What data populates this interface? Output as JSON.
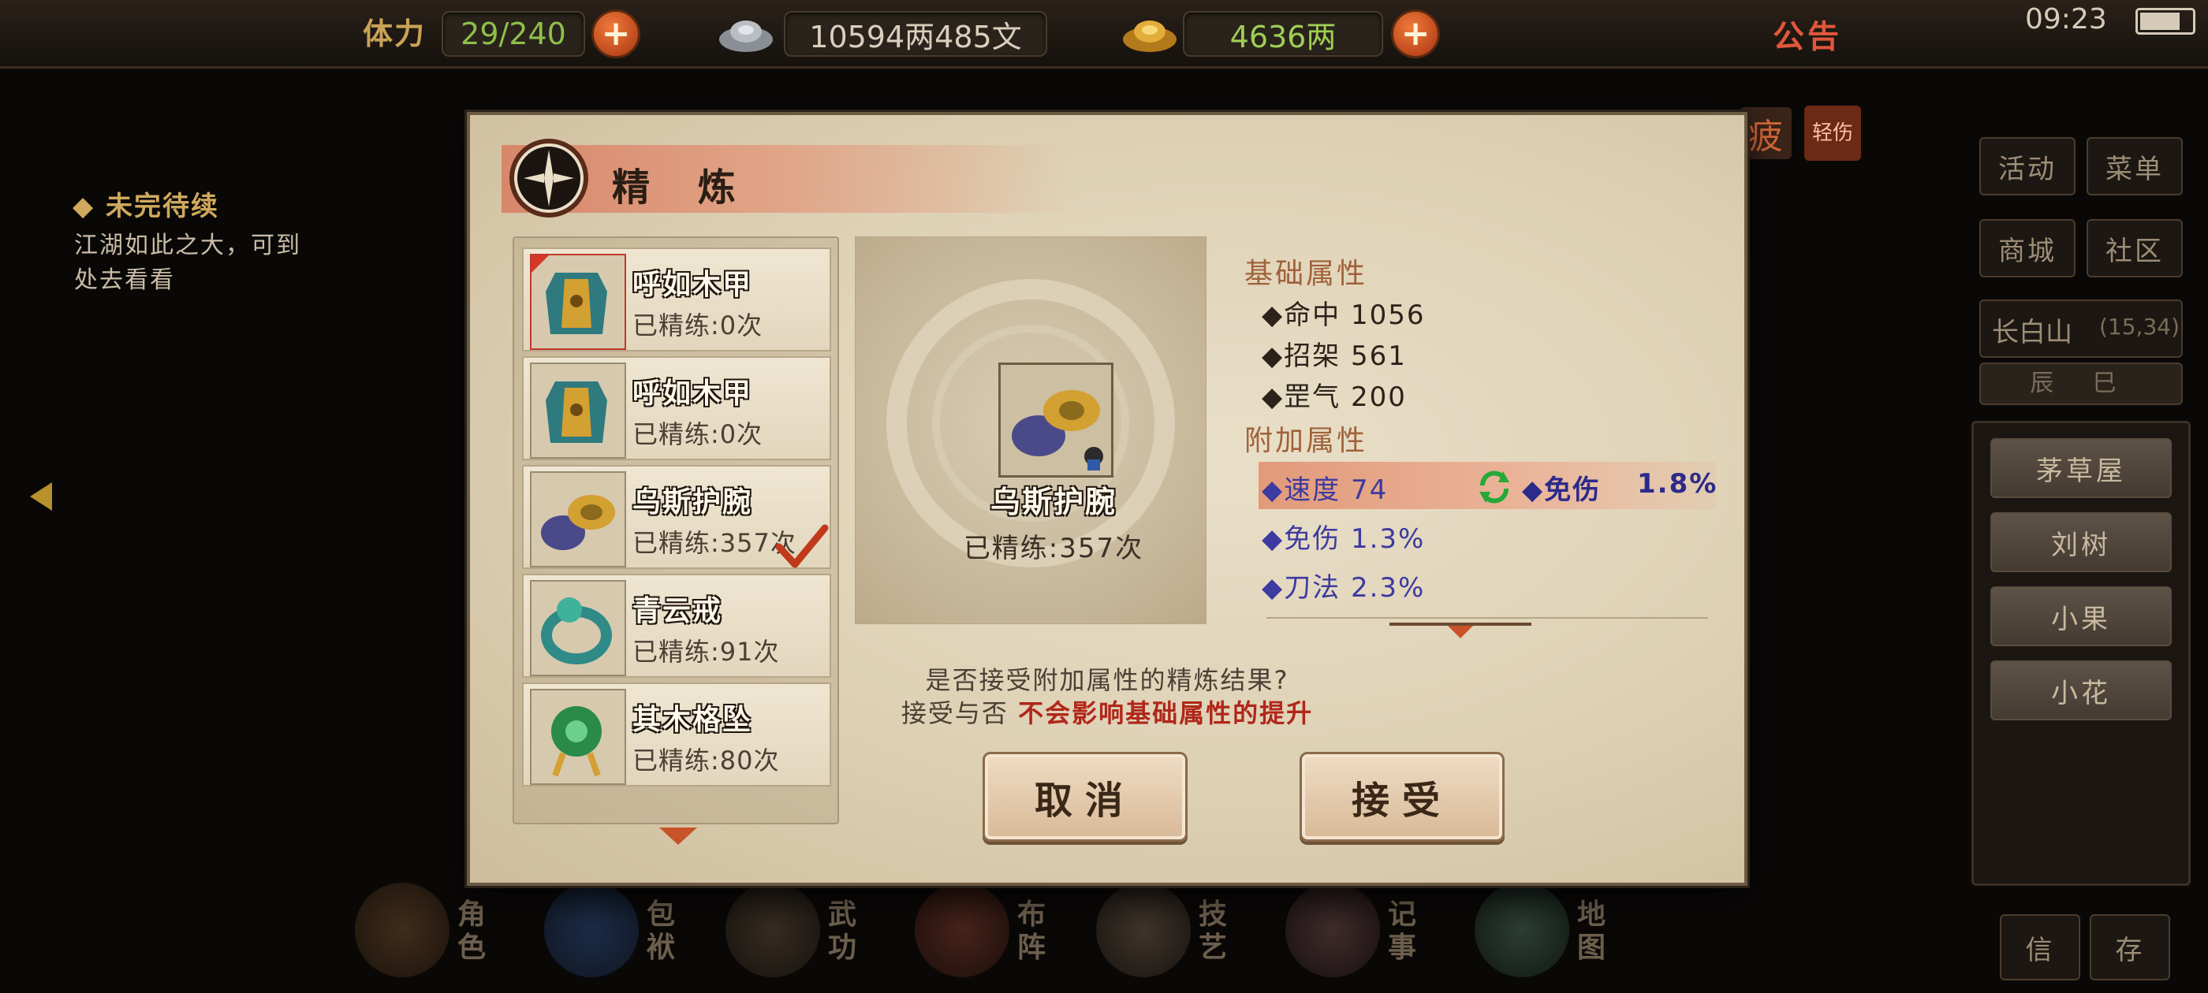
{
  "topbar": {
    "stamina_label": "体力",
    "stamina_value": "29/240",
    "silver_value": "10594两485文",
    "gold_value": "4636两",
    "notice_label": "公告",
    "clock": "09:23",
    "plus_symbol": "+"
  },
  "quest": {
    "title": "◆ 未完待续",
    "line1": "江湖如此之大，可到",
    "line2": "处去看看"
  },
  "side_menu": {
    "tired_badge": "疲",
    "light_badge": "轻伤",
    "buttons": [
      "活动",
      "菜单",
      "商城",
      "社区"
    ],
    "location": "长白山",
    "coords": "(15,34)",
    "time_period": "辰 巳",
    "npcs": [
      "茅草屋",
      "刘树",
      "小果",
      "小花"
    ],
    "bottom_buttons": [
      "信",
      "存"
    ]
  },
  "bottom_nav": [
    {
      "label": "角色",
      "icon": "character-icon"
    },
    {
      "label": "包袱",
      "icon": "bag-icon"
    },
    {
      "label": "武功",
      "icon": "martial-arts-icon"
    },
    {
      "label": "布阵",
      "icon": "formation-icon"
    },
    {
      "label": "技艺",
      "icon": "craft-icon"
    },
    {
      "label": "记事",
      "icon": "journal-icon"
    },
    {
      "label": "地图",
      "icon": "map-icon"
    }
  ],
  "dialog": {
    "title": "精 炼",
    "items": [
      {
        "name": "呼如木甲",
        "count": "已精练:0次",
        "icon": "armor-icon",
        "selected": true,
        "accepted": false
      },
      {
        "name": "呼如木甲",
        "count": "已精练:0次",
        "icon": "armor-icon",
        "selected": false,
        "accepted": false
      },
      {
        "name": "乌斯护腕",
        "count": "已精练:357次",
        "icon": "bracer-icon",
        "selected": false,
        "accepted": true
      },
      {
        "name": "青云戒",
        "count": "已精练:91次",
        "icon": "ring-icon",
        "selected": false,
        "accepted": false
      },
      {
        "name": "其木格坠",
        "count": "已精练:80次",
        "icon": "pendant-icon",
        "selected": false,
        "accepted": false
      }
    ],
    "preview": {
      "name": "乌斯护腕",
      "count": "已精练:357次"
    },
    "base_attrs": {
      "title": "基础属性",
      "lines": [
        "◆命中  1056",
        "◆招架  561",
        "◆罡气  200"
      ]
    },
    "extra_attrs": {
      "title": "附加属性",
      "highlight": {
        "left": "◆速度  74",
        "right_name": "◆免伤",
        "right_value": "1.8%"
      },
      "lines": [
        "◆免伤  1.3%",
        "◆刀法  2.3%"
      ]
    },
    "prompt_line1": "是否接受附加属性的精炼结果?",
    "prompt_line2_prefix": "接受与否 ",
    "prompt_line2_red": "不会影响基础属性的提升",
    "cancel_label": "取消",
    "accept_label": "接受"
  },
  "colors": {
    "accent_red": "#b0271a",
    "parchment": "#e2d6bd",
    "stamina_green": "#8fbf4a",
    "attr_blue": "#3d3aa0"
  }
}
